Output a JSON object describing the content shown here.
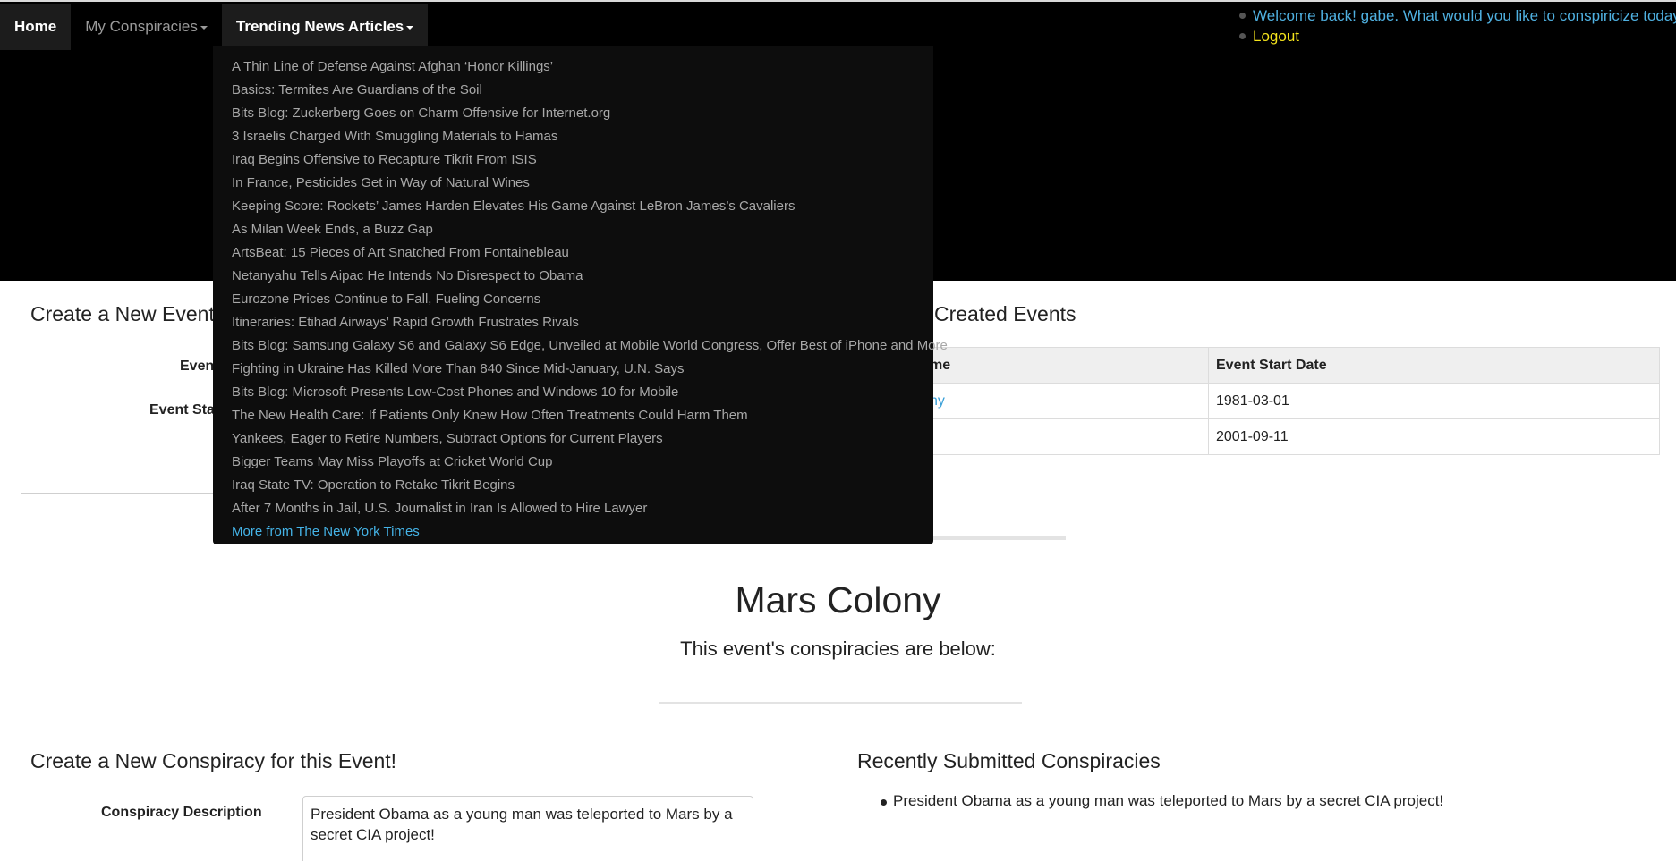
{
  "nav": {
    "home": "Home",
    "my_conspiracies": "My Conspiracies",
    "trending": "Trending News Articles"
  },
  "user_menu": {
    "welcome": "Welcome back! gabe. What would you like to conspiricize today?",
    "logout": "Logout"
  },
  "trending_articles": [
    "A Thin Line of Defense Against Afghan ‘Honor Killings’",
    "Basics: Termites Are Guardians of the Soil",
    "Bits Blog: Zuckerberg Goes on Charm Offensive for Internet.org",
    "3 Israelis Charged With Smuggling Materials to Hamas",
    "Iraq Begins Offensive to Recapture Tikrit From ISIS",
    "In France, Pesticides Get in Way of Natural Wines",
    "Keeping Score: Rockets’ James Harden Elevates His Game Against LeBron James’s Cavaliers",
    "As Milan Week Ends, a Buzz Gap",
    "ArtsBeat: 15 Pieces of Art Snatched From Fontainebleau",
    "Netanyahu Tells Aipac He Intends No Disrespect to Obama",
    "Eurozone Prices Continue to Fall, Fueling Concerns",
    "Itineraries: Etihad Airways’ Rapid Growth Frustrates Rivals",
    "Bits Blog: Samsung Galaxy S6 and Galaxy S6 Edge, Unveiled at Mobile World Congress, Offer Best of iPhone and More",
    "Fighting in Ukraine Has Killed More Than 840 Since Mid-January, U.N. Says",
    "Bits Blog: Microsoft Presents Low-Cost Phones and Windows 10 for Mobile",
    "The New Health Care: If Patients Only Knew How Often Treatments Could Harm Them",
    "Yankees, Eager to Retire Numbers, Subtract Options for Current Players",
    "Bigger Teams May Miss Playoffs at Cricket World Cup",
    "Iraq State TV: Operation to Retake Tikrit Begins",
    "After 7 Months in Jail, U.S. Journalist in Iran Is Allowed to Hire Lawyer"
  ],
  "more_link": "More from The New York Times",
  "create_event": {
    "title": "Create a New Event",
    "name_label_visible": "Even",
    "start_label_visible": "Event Sta"
  },
  "created_events": {
    "title_visible": "Created Events",
    "col_name_visible": "me",
    "col_date": "Event Start Date",
    "rows": [
      {
        "name_visible": "ny",
        "date": "1981-03-01"
      },
      {
        "name_visible": "",
        "date": "2001-09-11"
      }
    ]
  },
  "event": {
    "title": "Mars Colony",
    "subtitle": "This event's conspiracies are below:"
  },
  "create_conspiracy": {
    "title": "Create a New Conspiracy for this Event!",
    "desc_label": "Conspiracy Description",
    "desc_value": "President Obama as a young man was teleported to Mars by a secret CIA project!"
  },
  "recent": {
    "title": "Recently Submitted Conspiracies",
    "items": [
      "President Obama as a young man was teleported to Mars by a secret CIA project!"
    ]
  },
  "colors": {
    "header_bg": "#000000",
    "welcome": "#4fb0e0",
    "logout": "#f5e41c",
    "link": "#3aa0d8"
  }
}
